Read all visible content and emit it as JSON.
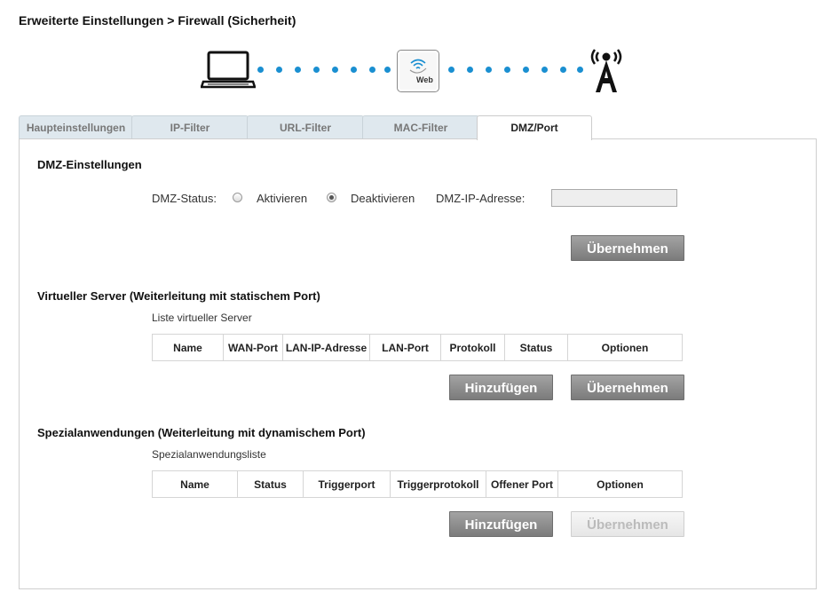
{
  "page": {
    "title": "Erweiterte Einstellungen > Firewall (Sicherheit)"
  },
  "connection": {
    "router_label": "Web",
    "dot_color": "#1a8fd1"
  },
  "tabs": [
    {
      "label": "Haupteinstellungen",
      "active": false
    },
    {
      "label": "IP-Filter",
      "active": false
    },
    {
      "label": "URL-Filter",
      "active": false
    },
    {
      "label": "MAC-Filter",
      "active": false
    },
    {
      "label": "DMZ/Port",
      "active": true
    }
  ],
  "dmz": {
    "title": "DMZ-Einstellungen",
    "status_label": "DMZ-Status:",
    "option_activate": "Aktivieren",
    "option_deactivate": "Deaktivieren",
    "selected": "Deaktivieren",
    "ip_label": "DMZ-IP-Adresse:",
    "ip_value": "",
    "apply_label": "Übernehmen"
  },
  "virtual_server": {
    "title": "Virtueller Server (Weiterleitung mit statischem Port)",
    "list_label": "Liste virtueller Server",
    "columns": [
      "Name",
      "WAN-Port",
      "LAN-IP-Adresse",
      "LAN-Port",
      "Protokoll",
      "Status",
      "Optionen"
    ],
    "add_label": "Hinzufügen",
    "apply_label": "Übernehmen"
  },
  "special_apps": {
    "title": "Spezialanwendungen (Weiterleitung mit dynamischem Port)",
    "list_label": "Spezialanwendungsliste",
    "columns": [
      "Name",
      "Status",
      "Triggerport",
      "Triggerprotokoll",
      "Offener Port",
      "Optionen"
    ],
    "add_label": "Hinzufügen",
    "apply_label": "Übernehmen"
  }
}
